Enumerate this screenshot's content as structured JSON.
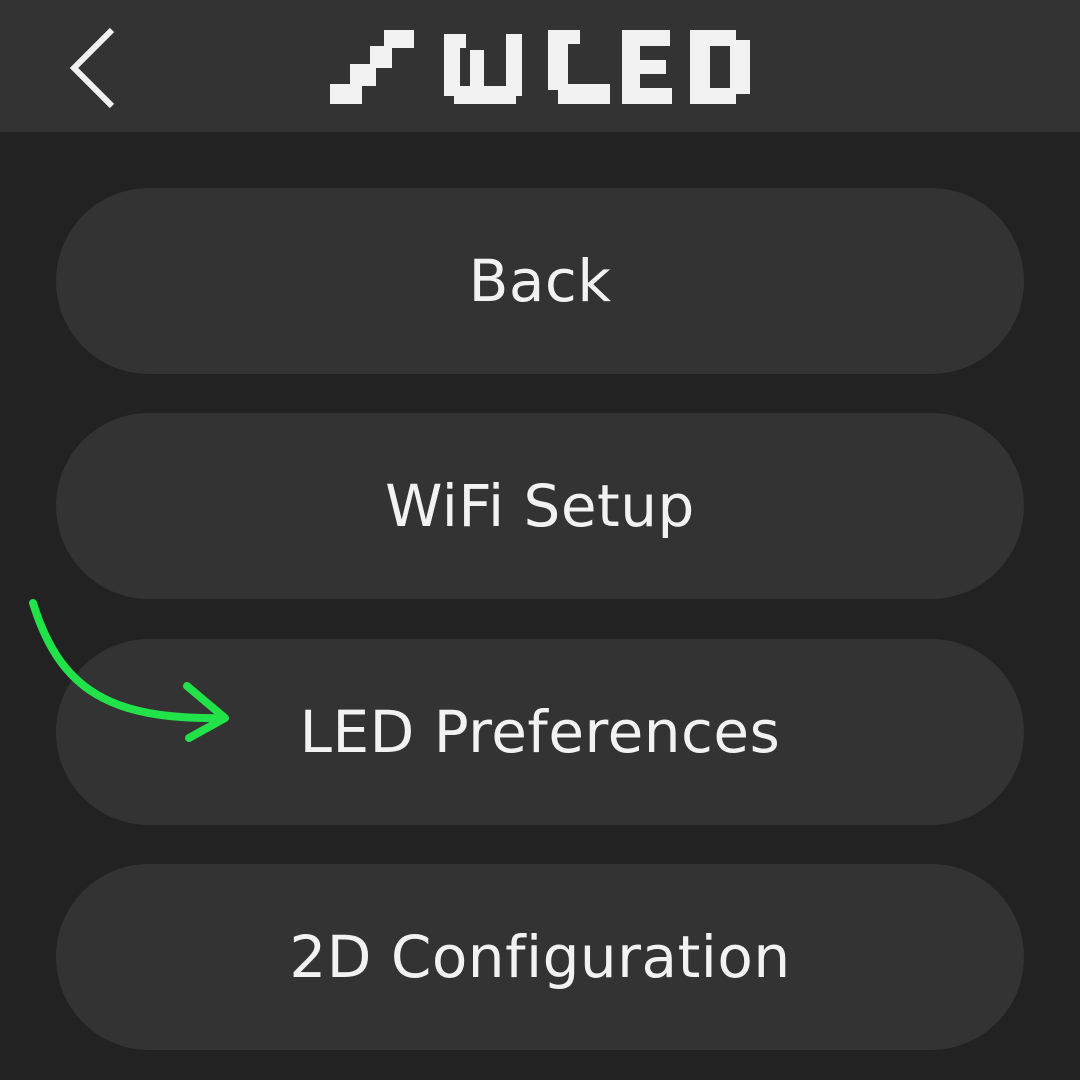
{
  "header": {
    "back_icon": "chevron-left-icon",
    "logo_text": "WLED"
  },
  "menu": {
    "items": [
      {
        "label": "Back"
      },
      {
        "label": "WiFi Setup"
      },
      {
        "label": "LED Preferences"
      },
      {
        "label": "2D Configuration"
      }
    ]
  },
  "annotation": {
    "icon": "curved-arrow-icon",
    "color": "#22e24a",
    "points_to": "LED Preferences"
  },
  "colors": {
    "background": "#222222",
    "header_bg": "#333333",
    "button_bg": "#333333",
    "text": "#f2f2f2"
  }
}
